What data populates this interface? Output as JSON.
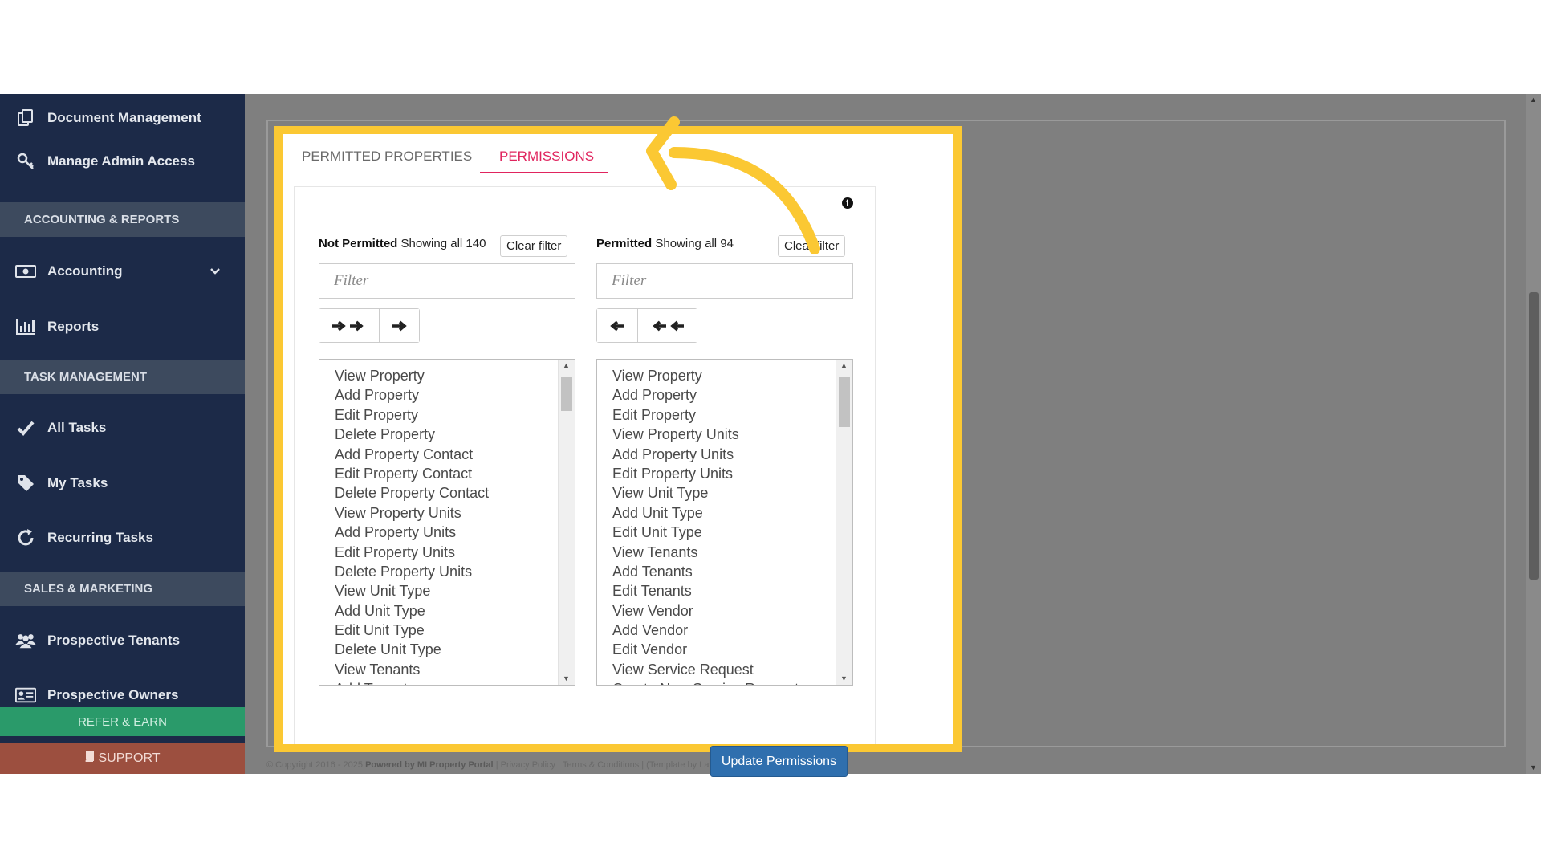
{
  "sidebar": {
    "items": [
      {
        "label": "Document Management",
        "icon": "document-copy-icon"
      },
      {
        "label": "Manage Admin Access",
        "icon": "key-icon"
      },
      {
        "label": "Accounting",
        "icon": "money-icon"
      },
      {
        "label": "Reports",
        "icon": "bar-chart-icon"
      },
      {
        "label": "All Tasks",
        "icon": "check-icon"
      },
      {
        "label": "My Tasks",
        "icon": "tag-icon"
      },
      {
        "label": "Recurring Tasks",
        "icon": "refresh-icon"
      },
      {
        "label": "Prospective Tenants",
        "icon": "users-icon"
      },
      {
        "label": "Prospective Owners",
        "icon": "id-card-icon"
      }
    ],
    "sections": {
      "accounting": "ACCOUNTING & REPORTS",
      "tasks": "TASK MANAGEMENT",
      "sales": "SALES & MARKETING"
    },
    "refer": "REFER & EARN",
    "support": "SUPPORT"
  },
  "tabs": {
    "permitted_properties": "PERMITTED PROPERTIES",
    "permissions": "PERMISSIONS"
  },
  "not_permitted": {
    "title": "Not Permitted",
    "showing": "Showing all 140",
    "clear": "Clear filter",
    "placeholder": "Filter",
    "items": [
      "View Property",
      "Add Property",
      "Edit Property",
      "Delete Property",
      "Add Property Contact",
      "Edit Property Contact",
      "Delete Property Contact",
      "View Property Units",
      "Add Property Units",
      "Edit Property Units",
      "Delete Property Units",
      "View Unit Type",
      "Add Unit Type",
      "Edit Unit Type",
      "Delete Unit Type",
      "View Tenants",
      "Add Tenants"
    ]
  },
  "permitted": {
    "title": "Permitted",
    "showing": "Showing all 94",
    "clear": "Clear filter",
    "placeholder": "Filter",
    "items": [
      "View Property",
      "Add Property",
      "Edit Property",
      "View Property Units",
      "Add Property Units",
      "Edit Property Units",
      "View Unit Type",
      "Add Unit Type",
      "Edit Unit Type",
      "View Tenants",
      "Add Tenants",
      "Edit Tenants",
      "View Vendor",
      "Add Vendor",
      "Edit Vendor",
      "View Service Request",
      "Create New Service Request"
    ]
  },
  "buttons": {
    "move_all": "➔➔",
    "move_selected": "➔",
    "remove_selected": "🠔",
    "remove_all": "🠔🠔",
    "update": "Update Permissions"
  },
  "footer": {
    "copyright": "© Copyright 2016 - 2025",
    "powered": "Powered by MI Property Portal",
    "links": "| Privacy Policy | Terms & Conditions | (Template by Lavork)"
  },
  "colors": {
    "sidebar": "#1c2a48",
    "accent_tab": "#e0245e",
    "highlight": "#fbc833",
    "primary_button": "#2f6fae"
  }
}
